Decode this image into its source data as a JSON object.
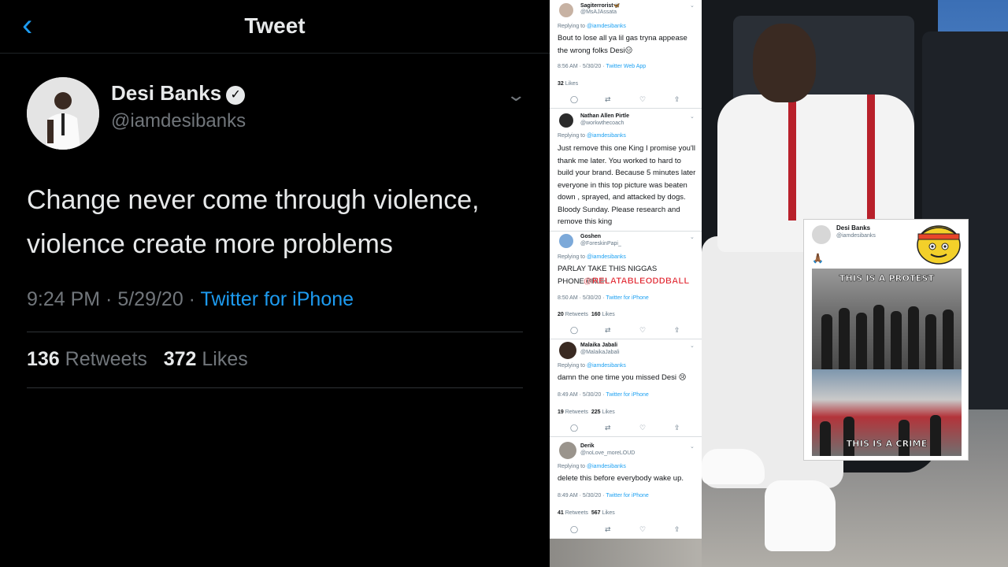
{
  "main_tweet": {
    "header_title": "Tweet",
    "author_name": "Desi Banks",
    "author_handle": "@iamdesibanks",
    "text": "Change never come through violence, violence create more problems",
    "time": "9:24 PM · 5/29/20 · ",
    "source": "Twitter for iPhone",
    "retweets_count": "136",
    "retweets_label": "Retweets",
    "likes_count": "372",
    "likes_label": "Likes"
  },
  "replies": [
    {
      "name": "Sagiterrorist🦋",
      "handle": "@MsAJAssata",
      "replying_prefix": "Replying to ",
      "replying_to": "@iamdesibanks",
      "text": "Bout to lose all ya lil gas tryna appease the wrong folks Desi😑",
      "time": "8:56 AM · 5/30/20 · ",
      "source": "Twitter Web App",
      "retweets": "",
      "likes": "32",
      "likes_label": "Likes"
    },
    {
      "name": "Nathan Allen Pirtle",
      "handle": "@workwthecoach",
      "replying_prefix": "Replying to ",
      "replying_to": "@iamdesibanks",
      "text": "Just remove this one King I promise you'll thank me later. You worked to hard to build your brand. Because 5 minutes later everyone in this top picture was beaten down , sprayed, and attacked by dogs. Bloody Sunday. Please research and remove this king"
    },
    {
      "name": "Goshen",
      "handle": "@ForeskinPapi_",
      "replying_prefix": "Replying to ",
      "replying_to": "@iamdesibanks",
      "text": "PARLAY TAKE THIS NIGGAS PHONE BRUH",
      "watermark": "@RELATABLEODDBALL",
      "time": "8:50 AM · 5/30/20 · ",
      "source": "Twitter for iPhone",
      "retweets": "20",
      "retweets_label": "Retweets",
      "likes": "160",
      "likes_label": "Likes"
    },
    {
      "name": "Malaika Jabali",
      "handle": "@MalaikaJabali",
      "replying_prefix": "Replying to ",
      "replying_to": "@iamdesibanks",
      "text": "damn the one time you missed Desi 😢",
      "time": "8:49 AM · 5/30/20 · ",
      "source": "Twitter for iPhone",
      "retweets": "19",
      "retweets_label": "Retweets",
      "likes": "225",
      "likes_label": "Likes"
    },
    {
      "name": "Derik",
      "handle": "@noLove_moreLOUD",
      "replying_prefix": "Replying to ",
      "replying_to": "@iamdesibanks",
      "text": "delete this before everybody wake up.",
      "time": "8:49 AM · 5/30/20 · ",
      "source": "Twitter for iPhone",
      "retweets": "41",
      "retweets_label": "Retweets",
      "likes": "567",
      "likes_label": "Likes"
    }
  ],
  "inset": {
    "author_name": "Desi Banks",
    "author_handle": "@iamdesibanks",
    "emoji": "🙏🏾",
    "caption_top": "THIS IS A PROTEST",
    "caption_bottom": "THIS IS A CRIME"
  },
  "icons": {
    "back": "chevron-left-icon",
    "verified": "verified-badge-icon",
    "more": "chevron-down-icon",
    "reply": "comment-icon",
    "retweet": "retweet-icon",
    "like": "heart-icon",
    "share": "share-icon"
  },
  "colors": {
    "accent": "#1d9bf0",
    "watermark": "#e0202a"
  }
}
